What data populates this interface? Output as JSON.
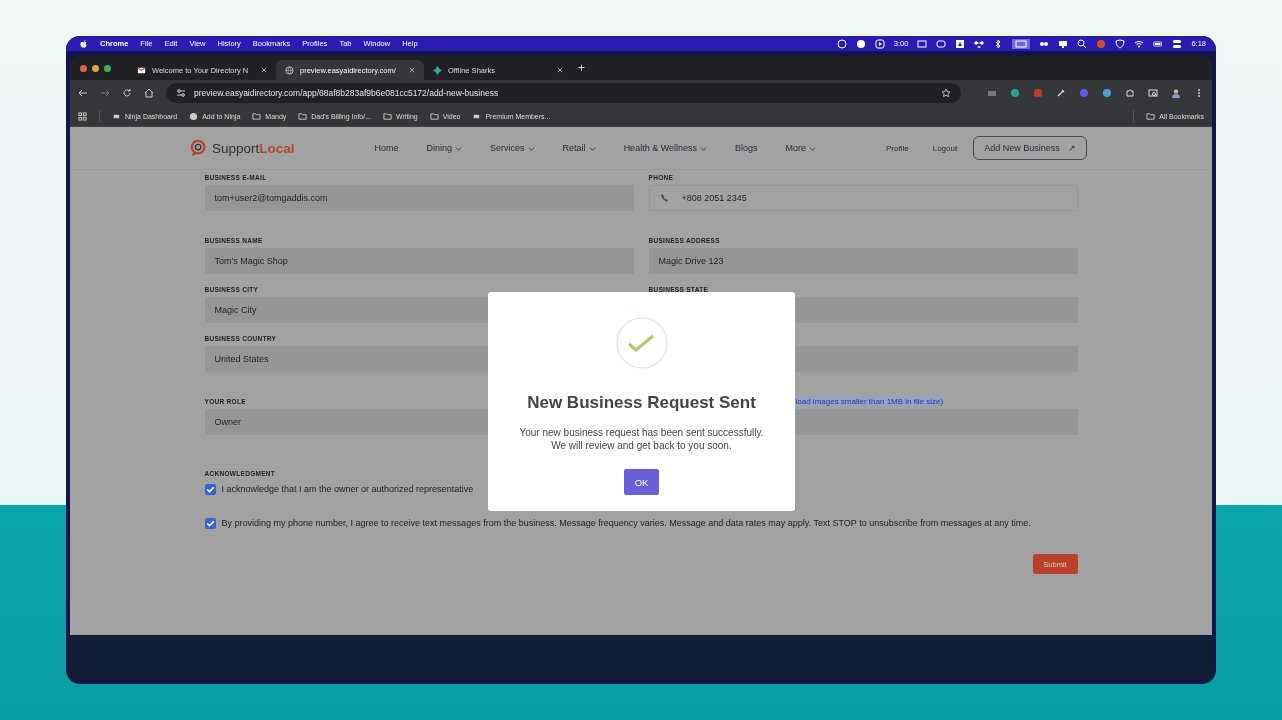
{
  "menu_bar": {
    "app": "Chrome",
    "items": [
      "File",
      "Edit",
      "View",
      "History",
      "Bookmarks",
      "Profiles",
      "Tab",
      "Window",
      "Help"
    ],
    "timer": "3:00",
    "clock": "6:18"
  },
  "browser": {
    "tabs": [
      {
        "title": "Welcome to Your Directory N",
        "selected": false,
        "kind": "mail"
      },
      {
        "title": "preview.easyaidirectory.com/",
        "selected": true,
        "kind": "globe"
      },
      {
        "title": "Offline Sharks",
        "selected": false,
        "kind": "app"
      }
    ],
    "new_tab": "+",
    "address": "preview.easyaidirectory.com/app/68af8b283af9b6e081cc5172/add-new-business",
    "bookmarks": [
      {
        "label": "Ninja Dashboard",
        "kind": "page"
      },
      {
        "label": "Add to Ninja",
        "kind": "globe"
      },
      {
        "label": "Mandy",
        "kind": "folder"
      },
      {
        "label": "Dad's Billing Info/...",
        "kind": "folder"
      },
      {
        "label": "Writing",
        "kind": "folder"
      },
      {
        "label": "Video",
        "kind": "folder"
      },
      {
        "label": "Premium Members...",
        "kind": "page"
      }
    ],
    "all_bookmarks": "All Bookmarks"
  },
  "site": {
    "logo": {
      "first": "Support",
      "second": "Local"
    },
    "nav": [
      {
        "label": "Home",
        "dropdown": false
      },
      {
        "label": "Dining",
        "dropdown": true
      },
      {
        "label": "Services",
        "dropdown": true
      },
      {
        "label": "Retail",
        "dropdown": true
      },
      {
        "label": "Health & Wellness",
        "dropdown": true
      },
      {
        "label": "Blogs",
        "dropdown": false
      },
      {
        "label": "More",
        "dropdown": true
      }
    ],
    "profile": "Profile",
    "logout": "Logout",
    "cta": "Add New Business",
    "cta_icon": "↗"
  },
  "form": {
    "fields": [
      {
        "label": "BUSINESS E-MAIL",
        "value": "tom+user2@tomgaddis.com",
        "kind": "text"
      },
      {
        "label": "PHONE",
        "value": "+808 2051 2345",
        "kind": "phone"
      },
      {
        "label": "BUSINESS NAME",
        "value": "Tom's Magic Shop",
        "kind": "text"
      },
      {
        "label": "BUSINESS ADDRESS",
        "value": "Magic Drive 123",
        "kind": "text"
      },
      {
        "label": "BUSINESS CITY",
        "value": "Magic City",
        "kind": "text"
      },
      {
        "label": "BUSINESS STATE",
        "kind": "text"
      },
      {
        "label": "BUSINESS COUNTRY",
        "value": "United States",
        "kind": "text"
      },
      {
        "kind": "text"
      },
      {
        "label": "YOUR ROLE",
        "value": "Owner",
        "kind": "text"
      },
      {
        "hint": "load images smaller than 1MB in file size)",
        "kind": "upload"
      }
    ],
    "acknowledgment": "ACKNOWLEDGMENT",
    "checks": [
      {
        "text": "I acknowledge that I am the owner or authorized representative",
        "checked": true
      },
      {
        "text": "By providing my phone number, I agree to receive text messages from the business. Message frequency varies. Message and data rates may apply. Text STOP to unsubscribe from messages at any time.",
        "checked": true
      }
    ],
    "submit": "Submit"
  },
  "modal": {
    "title": "New Business Request Sent",
    "message": [
      "Your new business request has been sent successfully.",
      "We will review and get back to you soon."
    ],
    "button": "OK"
  }
}
